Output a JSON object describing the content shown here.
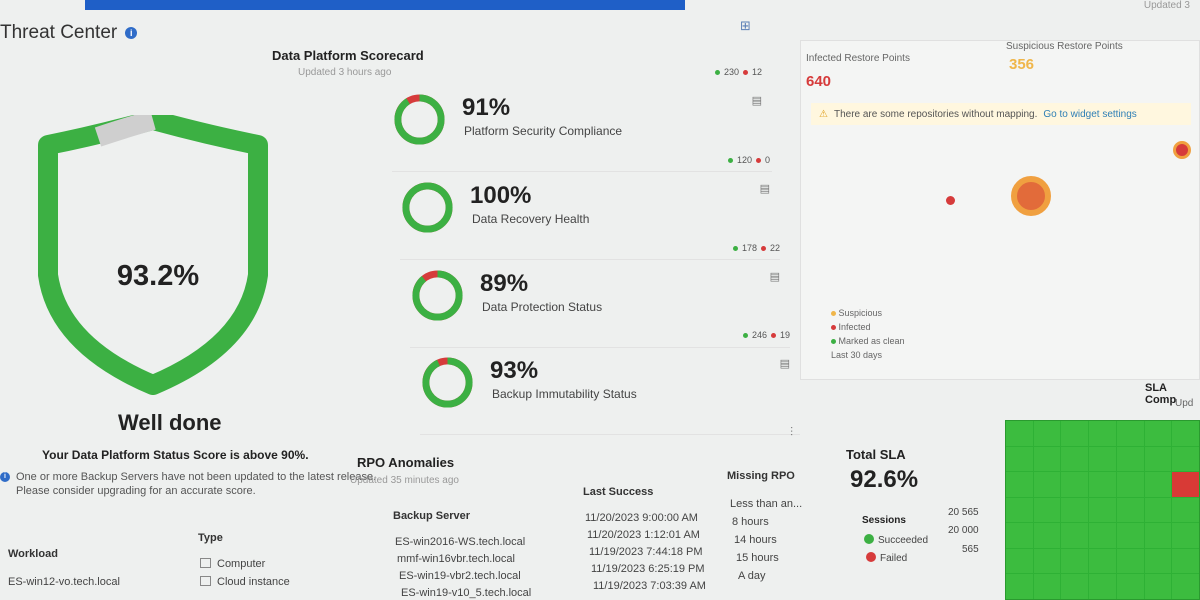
{
  "header": {
    "title": "Threat Center",
    "updated_right": "Updated 3"
  },
  "shield": {
    "score": "93.2%",
    "score_fraction": 0.932,
    "verdict": "Well done",
    "verdict_sub": "Your Data Platform Status Score is above 90%.",
    "notice": "One or more Backup Servers have not been updated to the latest release. Please consider upgrading for an accurate score."
  },
  "scorecard": {
    "title": "Data Platform Scorecard",
    "updated": "Updated 3 hours ago",
    "metrics": [
      {
        "value": "91%",
        "label": "Platform Security Compliance",
        "ok": "230",
        "bad": "12",
        "fraction": 0.91
      },
      {
        "value": "100%",
        "label": "Data Recovery Health",
        "ok": "120",
        "bad": "0",
        "fraction": 1.0
      },
      {
        "value": "89%",
        "label": "Data Protection Status",
        "ok": "178",
        "bad": "22",
        "fraction": 0.89
      },
      {
        "value": "93%",
        "label": "Backup Immutability Status",
        "ok": "246",
        "bad": "19",
        "fraction": 0.93
      }
    ]
  },
  "restore_points": {
    "infected_label": "Infected Restore Points",
    "infected_value": "640",
    "suspicious_label": "Suspicious Restore Points",
    "suspicious_value": "356",
    "warning": "There are some repositories without mapping.",
    "warning_link": "Go to widget settings",
    "legend": [
      "Suspicious",
      "Infected",
      "Marked as clean"
    ],
    "period": "Last 30 days"
  },
  "sla_compliance": {
    "title": "SLA Comp",
    "subtitle": "Upd"
  },
  "rpo": {
    "title": "RPO Anomalies",
    "updated": "Updated 35 minutes ago",
    "columns": [
      "Workload",
      "Type",
      "Backup Server",
      "Last Success",
      "Missing RPO"
    ],
    "rows": [
      {
        "workload": "ES-win12-vo.tech.local",
        "type": "Computer",
        "server": "ES-win2016-WS.tech.local",
        "last": "11/20/2023 9:00:00 AM",
        "missing": "Less than an..."
      },
      {
        "workload": "",
        "type": "Cloud instance",
        "server": "mmf-win16vbr.tech.local",
        "last": "11/20/2023 1:12:01 AM",
        "missing": "8 hours"
      },
      {
        "workload": "",
        "type": "",
        "server": "ES-win19-vbr2.tech.local",
        "last": "11/19/2023 7:44:18 PM",
        "missing": "14 hours"
      },
      {
        "workload": "",
        "type": "",
        "server": "ES-win19-v10_5.tech.local",
        "last": "11/19/2023 6:25:19 PM",
        "missing": "15 hours"
      },
      {
        "workload": "",
        "type": "",
        "server": "",
        "last": "11/19/2023 7:03:39 AM",
        "missing": "A day"
      }
    ]
  },
  "total_sla": {
    "label": "Total SLA",
    "value": "92.6%",
    "sessions_label": "Sessions",
    "sessions_total": "20 565",
    "succeeded_label": "Succeeded",
    "succeeded": "20 000",
    "failed_label": "Failed",
    "failed": "565"
  },
  "colors": {
    "ok": "#3cb043",
    "bad": "#d63b3b",
    "accent": "#1f5fc7"
  }
}
